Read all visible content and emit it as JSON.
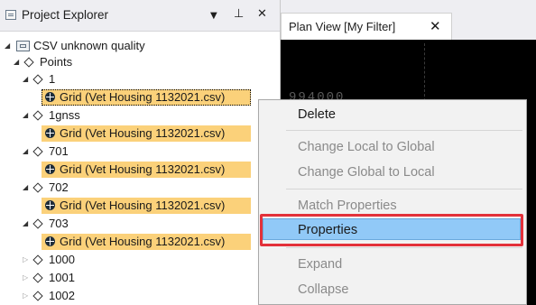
{
  "explorer": {
    "title": "Project Explorer",
    "dropdown_glyph": "▼",
    "pin_glyph": "⊥",
    "close_glyph": "✕"
  },
  "tree": {
    "root_label": "CSV unknown quality",
    "points_label": "Points",
    "nodes": [
      {
        "label": "1",
        "expanded": true,
        "child": "Grid (Vet Housing 1132021.csv)"
      },
      {
        "label": "1gnss",
        "expanded": true,
        "child": "Grid (Vet Housing 1132021.csv)"
      },
      {
        "label": "701",
        "expanded": true,
        "child": "Grid (Vet Housing 1132021.csv)"
      },
      {
        "label": "702",
        "expanded": true,
        "child": "Grid (Vet Housing 1132021.csv)"
      },
      {
        "label": "703",
        "expanded": true,
        "child": "Grid (Vet Housing 1132021.csv)"
      },
      {
        "label": "1000",
        "expanded": false
      },
      {
        "label": "1001",
        "expanded": false
      },
      {
        "label": "1002",
        "expanded": false
      }
    ],
    "expanded_glyph": "◢",
    "collapsed_glyph": "▷"
  },
  "plan_view": {
    "tab_label": "Plan View [My Filter]",
    "close_glyph": "✕",
    "canvas_text": "994000"
  },
  "context_menu": {
    "items": {
      "delete": "Delete",
      "change_local_to_global": "Change Local to Global",
      "change_global_to_local": "Change Global to Local",
      "match_properties": "Match Properties",
      "properties": "Properties",
      "expand": "Expand",
      "collapse": "Collapse"
    }
  },
  "colors": {
    "grid_row_highlight": "#fbd17a",
    "menu_selection": "#91c9f7",
    "annotation_box": "#e3313a",
    "canvas_background": "#000000"
  },
  "icons": {
    "explorer": "project-explorer-icon",
    "csv": "csv-file-icon",
    "point": "diamond-point-icon",
    "grid": "grid-globe-icon"
  }
}
